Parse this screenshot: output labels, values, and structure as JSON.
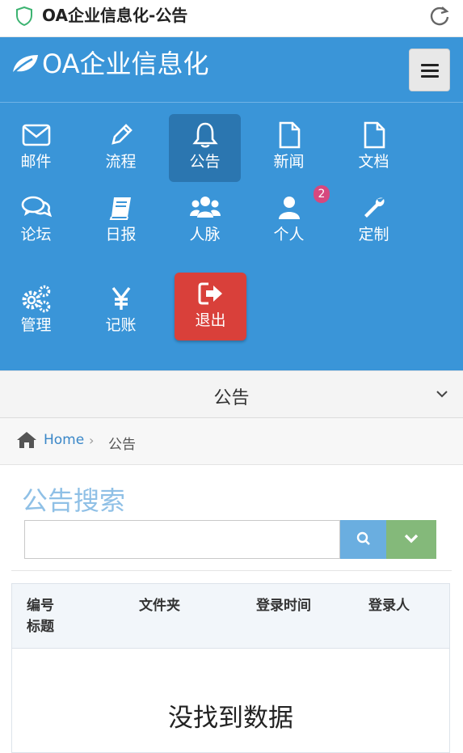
{
  "browser": {
    "title": "OA企业信息化-公告"
  },
  "navbar": {
    "brand": "OA企业信息化"
  },
  "shortcuts": [
    {
      "label": "邮件",
      "icon": "envelope-icon"
    },
    {
      "label": "流程",
      "icon": "pencil-icon"
    },
    {
      "label": "公告",
      "icon": "bell-icon",
      "active": true
    },
    {
      "label": "新闻",
      "icon": "file-icon"
    },
    {
      "label": "文档",
      "icon": "file-icon"
    },
    {
      "label": "论坛",
      "icon": "comments-icon"
    },
    {
      "label": "日报",
      "icon": "book-icon"
    },
    {
      "label": "人脉",
      "icon": "users-icon"
    },
    {
      "label": "个人",
      "icon": "user-icon",
      "badge": "2"
    },
    {
      "label": "定制",
      "icon": "wrench-icon"
    },
    {
      "label": "管理",
      "icon": "cogs-icon"
    },
    {
      "label": "记账",
      "icon": "yen-icon"
    },
    {
      "label": "退出",
      "icon": "sign-out-icon"
    }
  ],
  "section": {
    "title": "公告"
  },
  "breadcrumb": {
    "home": "Home",
    "separator": "›",
    "current": "公告"
  },
  "search": {
    "title": "公告搜索",
    "value": "",
    "placeholder": ""
  },
  "table": {
    "headers": {
      "number": "编号",
      "title": "标题",
      "folder": "文件夹",
      "login_time": "登录时间",
      "login_user": "登录人"
    },
    "empty_text": "没找到数据"
  },
  "colors": {
    "primary": "#3a95d8",
    "active_tile": "#2b76b0",
    "logout": "#d9403a",
    "badge": "#d6487e",
    "search_button": "#6aaee0",
    "expand_button": "#84b97a"
  }
}
